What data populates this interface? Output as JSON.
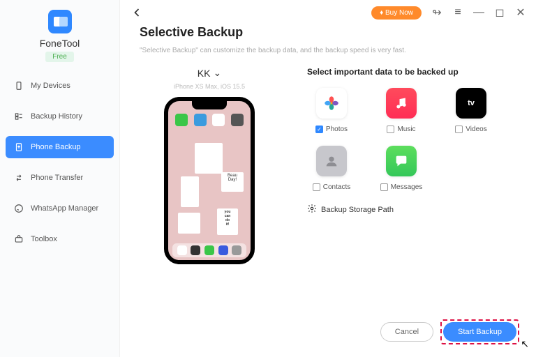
{
  "brand": "FoneTool",
  "badge": "Free",
  "nav": {
    "devices": "My Devices",
    "history": "Backup History",
    "backup": "Phone Backup",
    "transfer": "Phone Transfer",
    "whatsapp": "WhatsApp Manager",
    "toolbox": "Toolbox"
  },
  "topbar": {
    "buy": "Buy Now"
  },
  "page": {
    "title": "Selective Backup",
    "subtitle": "\"Selective Backup\" can customize the backup data, and the backup speed is very fast."
  },
  "device": {
    "name": "KK",
    "info": "iPhone XS Max, iOS 15.5"
  },
  "section": {
    "title": "Select important data to be backed up"
  },
  "items": {
    "photos": "Photos",
    "music": "Music",
    "videos": "Videos",
    "contacts": "Contacts",
    "messages": "Messages"
  },
  "storage": "Backup Storage Path",
  "actions": {
    "cancel": "Cancel",
    "start": "Start Backup"
  }
}
